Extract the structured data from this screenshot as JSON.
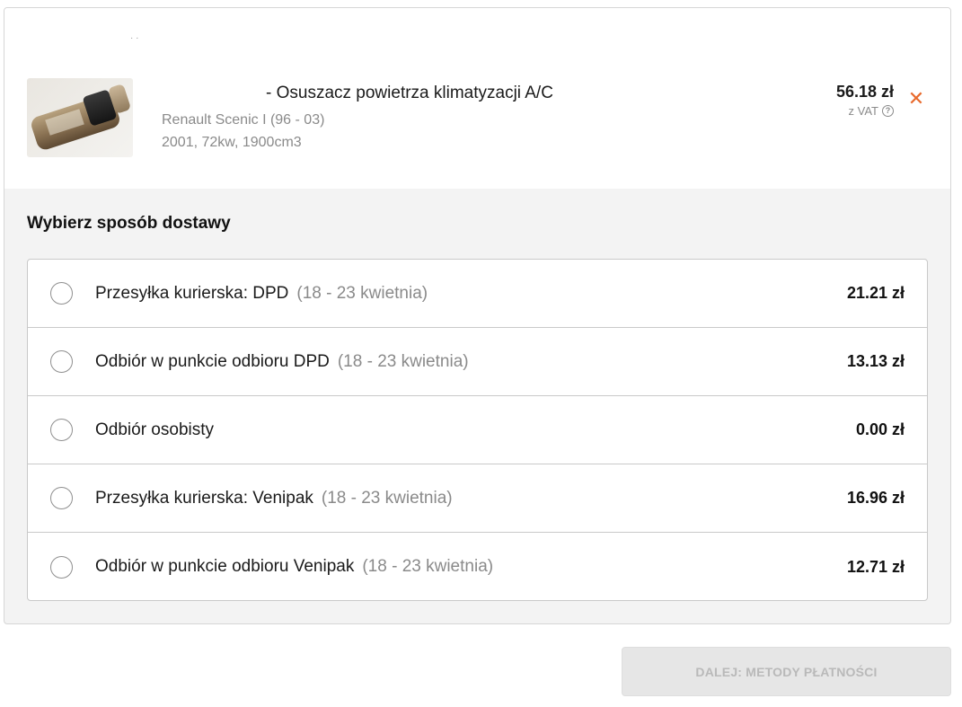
{
  "product": {
    "top_mark": "· ·",
    "title": "- Osuszacz powietrza klimatyzacji A/C",
    "car_model": "Renault Scenic I (96 - 03)",
    "car_details": "2001, 72kw, 1900cm3",
    "price": "56.18 zł",
    "vat_label": "z VAT",
    "help_glyph": "?",
    "remove_glyph": "✕",
    "remove_icon": "close-icon",
    "accent_color": "#e8692b"
  },
  "delivery": {
    "section_title": "Wybierz sposób dostawy",
    "options": [
      {
        "label": "Przesyłka kurierska: DPD",
        "date": "(18 - 23 kwietnia)",
        "price": "21.21 zł"
      },
      {
        "label": "Odbiór w punkcie odbioru DPD",
        "date": "(18 - 23 kwietnia)",
        "price": "13.13 zł"
      },
      {
        "label": "Odbiór osobisty",
        "date": "",
        "price": "0.00 zł"
      },
      {
        "label": "Przesyłka kurierska: Venipak",
        "date": "(18 - 23 kwietnia)",
        "price": "16.96 zł"
      },
      {
        "label": "Odbiór w punkcie odbioru Venipak",
        "date": "(18 - 23 kwietnia)",
        "price": "12.71 zł"
      }
    ]
  },
  "footer": {
    "next_label": "DALEJ: METODY PŁATNOŚCI"
  }
}
